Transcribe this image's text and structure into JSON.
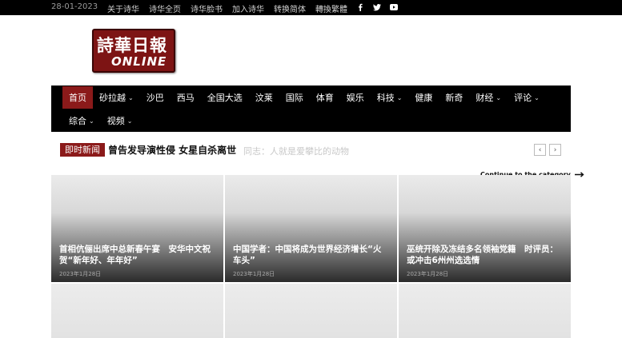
{
  "topbar": {
    "date": "28-01-2023",
    "links": [
      "关于诗华",
      "诗华全页",
      "诗华脸书",
      "加入诗华",
      "转换简体",
      "轉換繁體"
    ],
    "social_icons": [
      "facebook-icon",
      "twitter-icon",
      "youtube-icon"
    ]
  },
  "logo": {
    "cn": "詩華日報",
    "en": "ONLINE"
  },
  "nav": {
    "row1": [
      {
        "label": "首页",
        "active": true,
        "dropdown": false
      },
      {
        "label": "砂拉越",
        "active": false,
        "dropdown": true
      },
      {
        "label": "沙巴",
        "active": false,
        "dropdown": false
      },
      {
        "label": "西马",
        "active": false,
        "dropdown": false
      },
      {
        "label": "全国大选",
        "active": false,
        "dropdown": false
      },
      {
        "label": "汶莱",
        "active": false,
        "dropdown": false
      },
      {
        "label": "国际",
        "active": false,
        "dropdown": false
      },
      {
        "label": "体育",
        "active": false,
        "dropdown": false
      },
      {
        "label": "娱乐",
        "active": false,
        "dropdown": false
      },
      {
        "label": "科技",
        "active": false,
        "dropdown": true
      },
      {
        "label": "健康",
        "active": false,
        "dropdown": false
      },
      {
        "label": "新奇",
        "active": false,
        "dropdown": false
      },
      {
        "label": "财经",
        "active": false,
        "dropdown": true
      },
      {
        "label": "评论",
        "active": false,
        "dropdown": true
      }
    ],
    "row2": [
      {
        "label": "综合",
        "active": false,
        "dropdown": true
      },
      {
        "label": "视频",
        "active": false,
        "dropdown": true
      }
    ]
  },
  "ticker": {
    "tag": "即时新闻",
    "headline": "曾告发导演性侵  女星自杀离世",
    "ghost": "同志：人就是爱攀比的动物"
  },
  "continue_label": "Continue to the category",
  "cards": [
    {
      "title": "首相伉俪出席中总新春午宴　安华中文祝贺“新年好、年年好”",
      "date": "2023年1月28日"
    },
    {
      "title": "中国学者：中国将成为世界经济增长“火车头”",
      "date": "2023年1月28日"
    },
    {
      "title": "巫统开除及冻结多名领袖党籍　时评员：或冲击6州州选选情",
      "date": "2023年1月28日"
    }
  ],
  "colors": {
    "accent": "#8b1a1a",
    "nav_bg": "#000000"
  }
}
